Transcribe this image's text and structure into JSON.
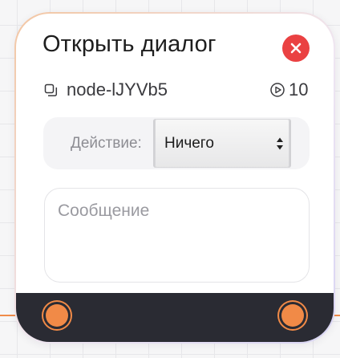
{
  "node": {
    "title": "Открыть диалог",
    "id_label": "node-lJYVb5",
    "run_count": "10",
    "action": {
      "label": "Действие:",
      "selected": "Ничего"
    },
    "message": {
      "placeholder": "Сообщение",
      "value": ""
    }
  },
  "colors": {
    "close": "#ea4142",
    "port": "#f18a47",
    "footer": "#2a2b33",
    "edge": "#f08c4a"
  },
  "icons": {
    "close": "close-icon",
    "copy": "copy-icon",
    "run": "play-circle-icon",
    "select": "chevron-up-down-icon"
  }
}
